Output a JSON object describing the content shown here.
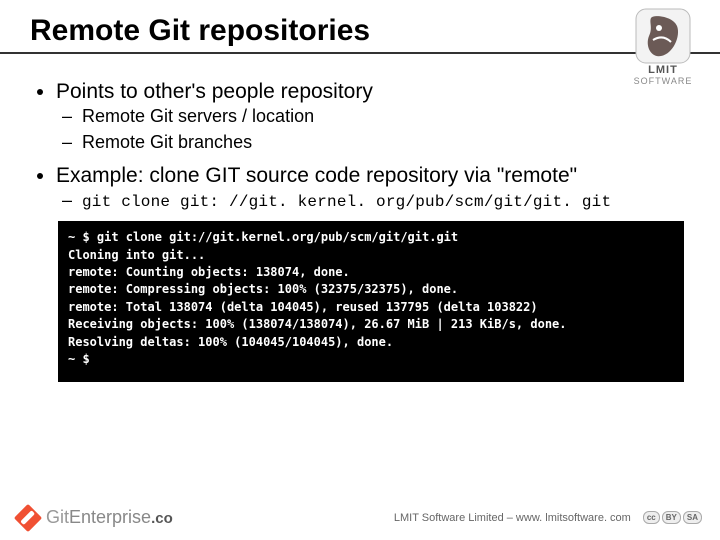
{
  "title": "Remote Git repositories",
  "logo": {
    "label": "LMIT",
    "sublabel": "SOFTWARE"
  },
  "bullets": {
    "b1": {
      "text": "Points to other's people repository",
      "sub1": "Remote Git servers / location",
      "sub2": "Remote Git branches"
    },
    "b2": {
      "text": "Example: clone GIT source code repository via \"remote\"",
      "cmd": "git clone git: //git. kernel. org/pub/scm/git/git. git"
    }
  },
  "terminal": {
    "t1": "~ $ git clone git://git.kernel.org/pub/scm/git/git.git",
    "t2": "Cloning into git...",
    "t3": "remote: Counting objects: 138074, done.",
    "t4": "remote: Compressing objects: 100% (32375/32375), done.",
    "t5": "remote: Total 138074 (delta 104045), reused 137795 (delta 103822)",
    "t6": "Receiving objects: 100% (138074/138074), 26.67 MiB | 213 KiB/s, done.",
    "t7": "Resolving deltas: 100% (104045/104045), done.",
    "t8": "~ $"
  },
  "footer": {
    "brand_git": "Git",
    "brand_ent": "Enterprise",
    "brand_dom": ".co",
    "copyright": "LMIT Software Limited – www. lmitsoftware. com",
    "cc1": "cc",
    "cc2": "BY",
    "cc3": "SA"
  }
}
